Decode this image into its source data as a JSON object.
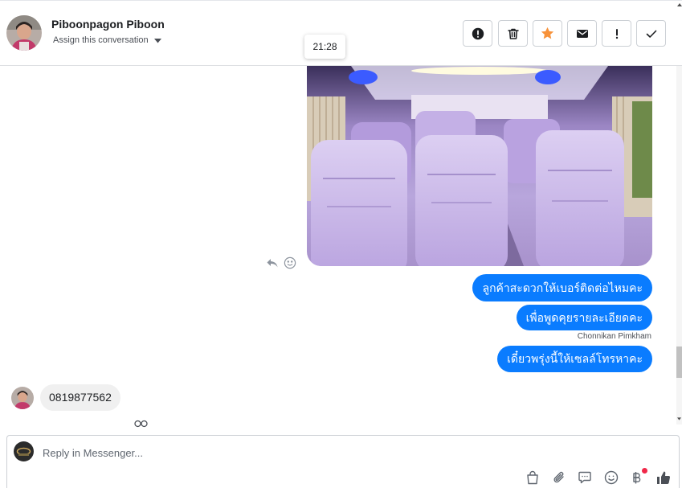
{
  "header": {
    "contact_name": "Piboonpagon Piboon",
    "assign_label": "Assign this conversation",
    "actions": [
      {
        "icon": "report-icon"
      },
      {
        "icon": "trash-icon"
      },
      {
        "icon": "star-icon"
      },
      {
        "icon": "envelope-icon"
      },
      {
        "icon": "exclamation-icon"
      },
      {
        "icon": "check-icon"
      }
    ]
  },
  "tooltip": {
    "time": "21:28"
  },
  "conversation": {
    "outgoing_messages": [
      "ลูกค้าสะดวกให้เบอร์ติดต่อไหมคะ",
      "เพื่อพูดคุยรายละเอียดคะ",
      "เดี๋ยวพรุ่งนี้ให้เซลล์โทรหาคะ"
    ],
    "sender_label": "Chonnikan Pimkham",
    "incoming_message": "0819877562",
    "message_actions": [
      "reply-icon",
      "react-emoji-icon"
    ]
  },
  "composer": {
    "placeholder": "Reply in Messenger...",
    "tools": [
      "shopping-bag-icon",
      "paperclip-icon",
      "saved-reply-icon",
      "emoji-icon",
      "baht-payment-icon",
      "thumbs-up-icon"
    ]
  },
  "colors": {
    "outgoing_bubble": "#0a7cff",
    "incoming_bubble": "#f0f0f0",
    "star": "#f7923a",
    "notification_dot": "#f02849"
  }
}
